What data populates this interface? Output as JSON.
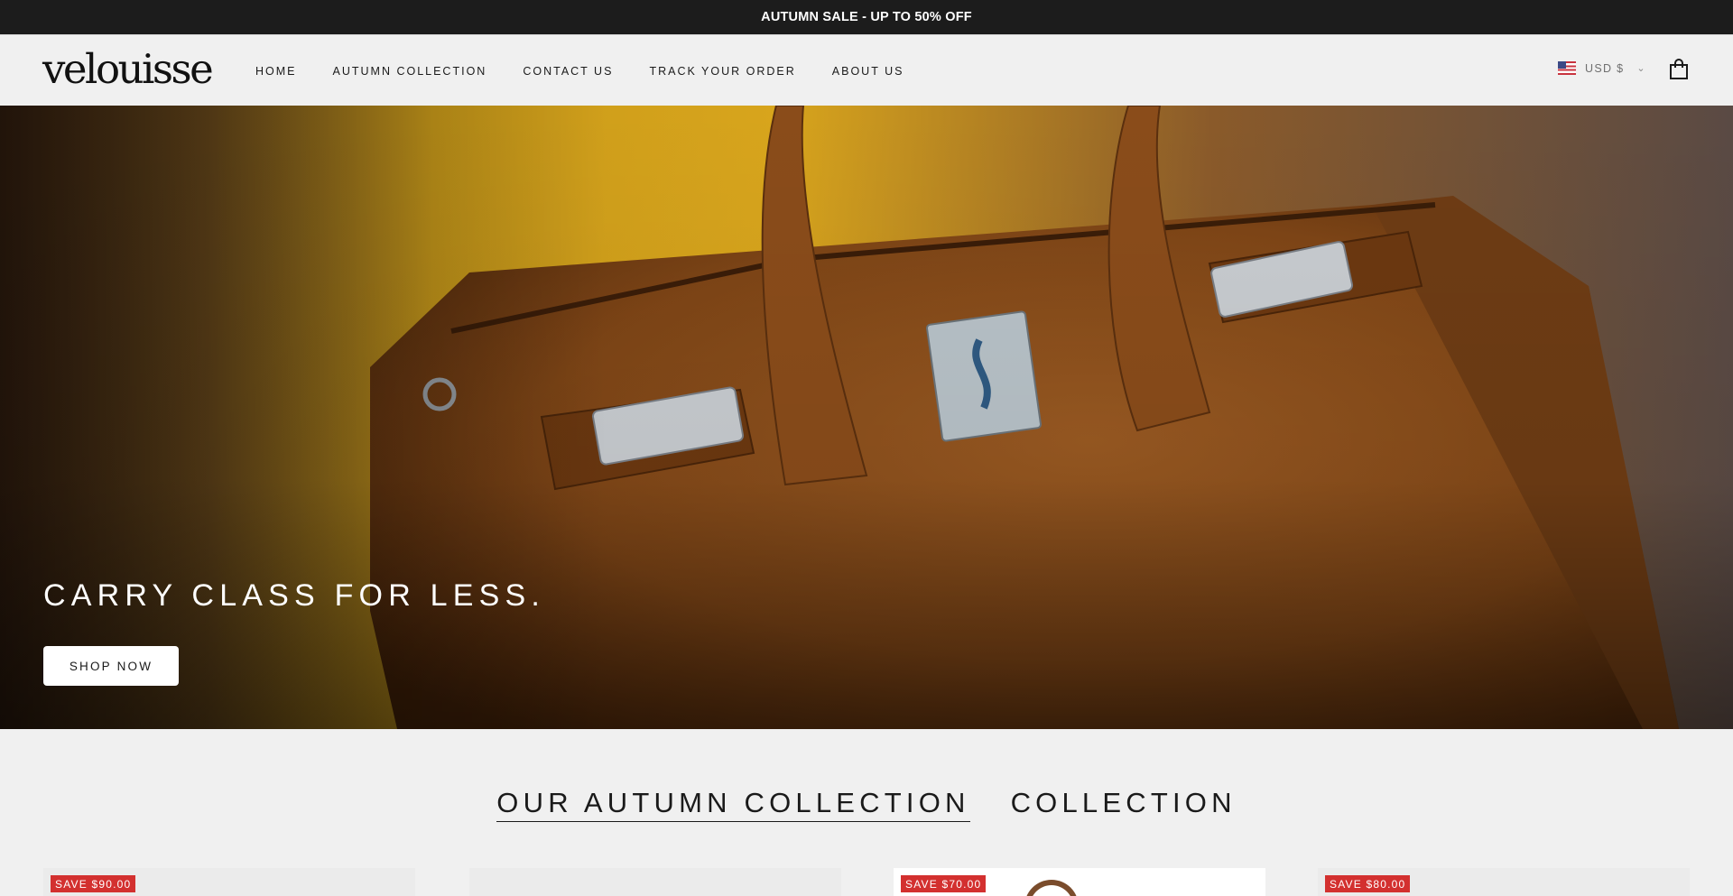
{
  "announcement": {
    "text": "AUTUMN SALE - UP TO 50% OFF"
  },
  "header": {
    "logo": "velouisse",
    "nav": [
      {
        "label": "HOME"
      },
      {
        "label": "AUTUMN COLLECTION"
      },
      {
        "label": "CONTACT US"
      },
      {
        "label": "TRACK YOUR ORDER"
      },
      {
        "label": "ABOUT US"
      }
    ],
    "currency": {
      "label": "USD $",
      "flag_icon": "us-flag-icon"
    },
    "cart_icon": "shopping-bag-icon"
  },
  "hero": {
    "title": "CARRY CLASS FOR LESS.",
    "button_label": "SHOP NOW",
    "image_icon": "suede-handbag-image"
  },
  "collection": {
    "tabs": [
      {
        "label": "OUR AUTUMN COLLECTION",
        "active": true
      },
      {
        "label": "COLLECTION",
        "active": false
      }
    ]
  },
  "products": [
    {
      "badge": "SAVE $90.00"
    },
    {
      "badge": ""
    },
    {
      "badge": "SAVE $70.00"
    },
    {
      "badge": "SAVE $80.00"
    }
  ],
  "colors": {
    "announcement_bg": "#1c1c1c",
    "page_bg": "#f0f0f0",
    "sale_badge": "#d3302f",
    "hero_suede": "#8a4f1f"
  }
}
